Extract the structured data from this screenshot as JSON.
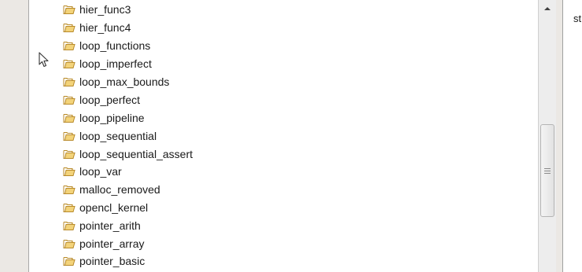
{
  "tree": {
    "items": [
      {
        "label": "hier_func3",
        "icon": "folder-open-icon"
      },
      {
        "label": "hier_func4",
        "icon": "folder-open-icon"
      },
      {
        "label": "loop_functions",
        "icon": "folder-open-icon"
      },
      {
        "label": "loop_imperfect",
        "icon": "folder-open-icon"
      },
      {
        "label": "loop_max_bounds",
        "icon": "folder-open-icon"
      },
      {
        "label": "loop_perfect",
        "icon": "folder-open-icon"
      },
      {
        "label": "loop_pipeline",
        "icon": "folder-open-icon"
      },
      {
        "label": "loop_sequential",
        "icon": "folder-open-icon"
      },
      {
        "label": "loop_sequential_assert",
        "icon": "folder-open-icon"
      },
      {
        "label": "loop_var",
        "icon": "folder-open-icon"
      },
      {
        "label": "malloc_removed",
        "icon": "folder-open-icon"
      },
      {
        "label": "opencl_kernel",
        "icon": "folder-open-icon"
      },
      {
        "label": "pointer_arith",
        "icon": "folder-open-icon"
      },
      {
        "label": "pointer_array",
        "icon": "folder-open-icon"
      },
      {
        "label": "pointer_basic",
        "icon": "folder-open-icon"
      }
    ]
  },
  "right_panel": {
    "partial_text": "st"
  },
  "colors": {
    "folder_fill": "#f3d37a",
    "folder_stroke": "#b88a2a",
    "folder_doc": "#ffffff",
    "tree_bg": "#ffffff",
    "frame_bg": "#ebe8e4"
  }
}
